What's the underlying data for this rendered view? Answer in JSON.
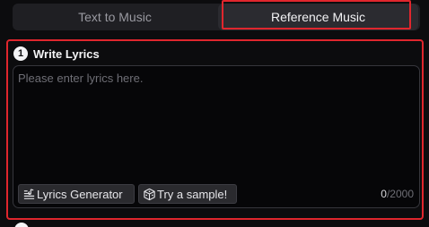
{
  "tabs": [
    {
      "label": "Text to Music",
      "active": false
    },
    {
      "label": "Reference Music",
      "active": true
    }
  ],
  "lyrics_section": {
    "step": "1",
    "title": "Write Lyrics",
    "placeholder": "Please enter lyrics here.",
    "value": "",
    "generator_label": "Lyrics Generator",
    "sample_label": "Try a sample!",
    "char_count": "0",
    "char_limit": "/2000"
  },
  "icons": {
    "generator": "lyrics-lines-icon",
    "sample": "dice-icon"
  },
  "colors": {
    "highlight": "#e0262d",
    "background": "#0c0c0e"
  }
}
